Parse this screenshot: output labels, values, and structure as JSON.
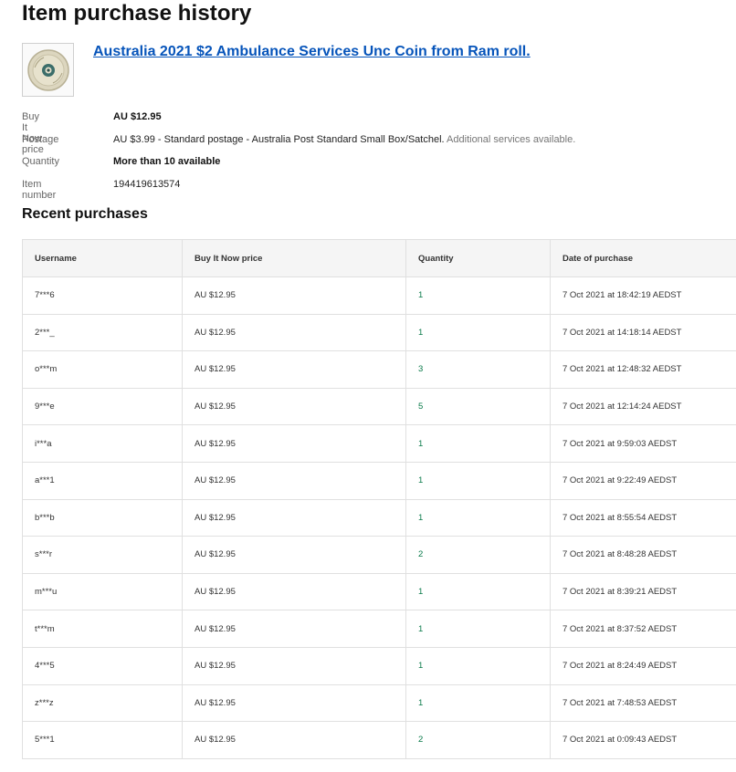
{
  "page": {
    "title": "Item purchase history"
  },
  "item": {
    "image_icon": "coin-image",
    "title": "Australia 2021 $2 Ambulance Services Unc Coin from Ram roll.",
    "details": {
      "price_label": "Buy It Now price",
      "price_value": "AU $12.95",
      "postage_label": "Postage",
      "postage_value": "AU $3.99 - Standard postage - Australia Post Standard Small Box/Satchel.",
      "postage_extra": "Additional services available.",
      "quantity_label": "Quantity",
      "quantity_value": "More than 10 available",
      "item_number_label": "Item number",
      "item_number_value": "194419613574"
    }
  },
  "recent": {
    "heading": "Recent purchases",
    "columns": [
      "Username",
      "Buy It Now price",
      "Quantity",
      "Date of purchase"
    ],
    "rows": [
      {
        "user": "7***6",
        "price": "AU $12.95",
        "qty": "1",
        "date": "7 Oct 2021 at 18:42:19 AEDST"
      },
      {
        "user": "2***_",
        "price": "AU $12.95",
        "qty": "1",
        "date": "7 Oct 2021 at 14:18:14 AEDST"
      },
      {
        "user": "o***m",
        "price": "AU $12.95",
        "qty": "3",
        "date": "7 Oct 2021 at 12:48:32 AEDST"
      },
      {
        "user": "9***e",
        "price": "AU $12.95",
        "qty": "5",
        "date": "7 Oct 2021 at 12:14:24 AEDST"
      },
      {
        "user": "i***a",
        "price": "AU $12.95",
        "qty": "1",
        "date": "7 Oct 2021 at 9:59:03 AEDST"
      },
      {
        "user": "a***1",
        "price": "AU $12.95",
        "qty": "1",
        "date": "7 Oct 2021 at 9:22:49 AEDST"
      },
      {
        "user": "b***b",
        "price": "AU $12.95",
        "qty": "1",
        "date": "7 Oct 2021 at 8:55:54 AEDST"
      },
      {
        "user": "s***r",
        "price": "AU $12.95",
        "qty": "2",
        "date": "7 Oct 2021 at 8:48:28 AEDST"
      },
      {
        "user": "m***u",
        "price": "AU $12.95",
        "qty": "1",
        "date": "7 Oct 2021 at 8:39:21 AEDST"
      },
      {
        "user": "t***m",
        "price": "AU $12.95",
        "qty": "1",
        "date": "7 Oct 2021 at 8:37:52 AEDST"
      },
      {
        "user": "4***5",
        "price": "AU $12.95",
        "qty": "1",
        "date": "7 Oct 2021 at 8:24:49 AEDST"
      },
      {
        "user": "z***z",
        "price": "AU $12.95",
        "qty": "1",
        "date": "7 Oct 2021 at 7:48:53 AEDST"
      },
      {
        "user": "5***1",
        "price": "AU $12.95",
        "qty": "2",
        "date": "7 Oct 2021 at 0:09:43 AEDST"
      }
    ]
  },
  "colors": {
    "link": "#0654ba",
    "quantity": "#0a7a4a",
    "header_bg": "#f5f5f5"
  }
}
